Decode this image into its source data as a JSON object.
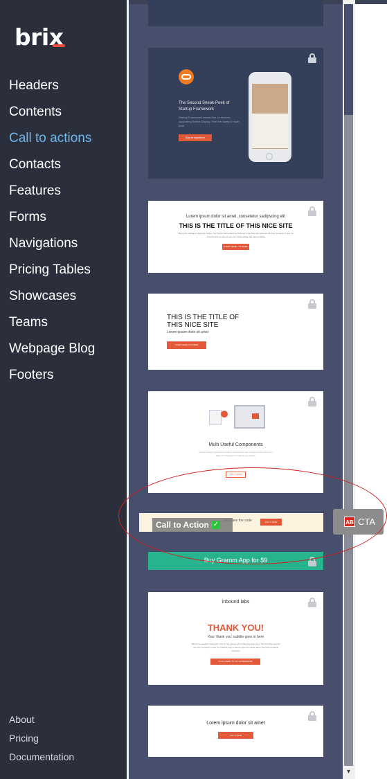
{
  "brand": {
    "logo_text": "brix",
    "accent_color": "#e74c3c"
  },
  "sidebar": {
    "items": [
      {
        "label": "Headers"
      },
      {
        "label": "Contents"
      },
      {
        "label": "Call to actions",
        "active": true
      },
      {
        "label": "Contacts"
      },
      {
        "label": "Features"
      },
      {
        "label": "Forms"
      },
      {
        "label": "Navigations"
      },
      {
        "label": "Pricing Tables"
      },
      {
        "label": "Showcases"
      },
      {
        "label": "Teams"
      },
      {
        "label": "Webpage Blog"
      },
      {
        "label": "Footers"
      }
    ],
    "bottom_links": [
      {
        "label": "About"
      },
      {
        "label": "Pricing"
      },
      {
        "label": "Documentation"
      }
    ]
  },
  "previews": {
    "p1": {
      "heading": "The Second Sneak-Peek of Startup Framework",
      "body": "Startup Framework assets fine on devices supporting Retina Display. Feel the clarity in each pixel.",
      "button": "Buy in Appstore"
    },
    "p2": {
      "subtitle": "Lorem ipsum dolor sit amet, consetetur sadipscing elit",
      "title": "THIS IS THE TITLE OF THIS NICE SITE",
      "body": "Being the savage's bowsman, that is, the person who pulled the bow-oar in his boat (the second one from forward), it was my cheerful duty to attend upon him while taking that hard-scrabble",
      "button": "START HERE, IT'S FREE"
    },
    "p3": {
      "title_line1": "THIS IS THE TITLE OF",
      "title_line2": "THIS NICE SITE",
      "subtitle": "Lorem ipsum dolor sit amet",
      "button": "START HERE IT'S FREE"
    },
    "p4": {
      "title": "Multi Useful Components",
      "body": "Startup Design Framework contains components and complex blocks which can easily be integrated into almost any design.",
      "button": "TRY IT NOW"
    },
    "p5": {
      "text": "you have the code",
      "button": "TRY IT NOW"
    },
    "p6": {
      "text": "Buy Gramm App for $9"
    },
    "p7": {
      "brand": "inbound labs",
      "title": "THANK YOU!",
      "subtitle": "Your 'thank you' subtitle goes in here",
      "body": "Being the savage's bowsman, that is, the person who pulled the bow-oar in his boat (the second one from forward), it was my cheerful duty to attend upon him while taking that hard-scrabble scramble",
      "button": "CLICK HERE TO GO SOMEWHERE"
    },
    "p8": {
      "title": "Lorem ipsum dolor sit amet",
      "button": "TRY IT NOW"
    }
  },
  "drag": {
    "label": "Call to Action 6",
    "check_icon": "check-icon",
    "tag_badge": "AB",
    "tag_text": "CTA"
  },
  "icons": {
    "lock": "lock-icon",
    "scroll_down": "chevron-down-icon"
  }
}
